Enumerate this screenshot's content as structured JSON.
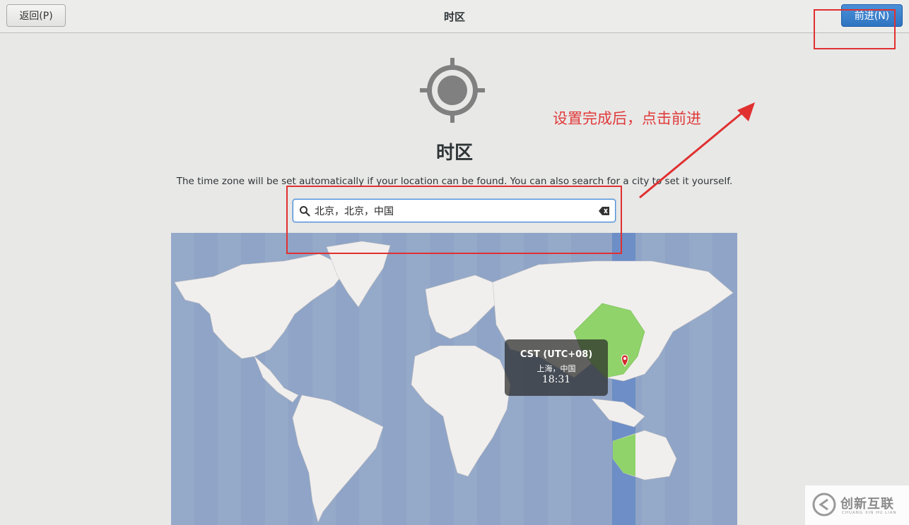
{
  "header": {
    "back_label": "返回(P)",
    "title": "时区",
    "next_label": "前进(N)"
  },
  "main": {
    "title": "时区",
    "description": "The time zone will be set automatically if your location can be found. You can also search for a city to set it yourself.",
    "search": {
      "value": "北京，北京，中国"
    }
  },
  "map": {
    "tooltip": {
      "zone": "CST (UTC+08)",
      "city": "上海，中国",
      "time": "18:31"
    }
  },
  "annotation": {
    "text": "设置完成后，点击前进"
  },
  "watermark": {
    "text": "创新互联",
    "sub": "CHUANG XIN HU LIAN"
  },
  "colors": {
    "accent": "#4a90d9",
    "annotation": "#e03a3a",
    "ocean": "#8fa4c6",
    "land": "#f1efee",
    "selected_country": "#8fd36a"
  },
  "icons": [
    "location-crosshair-icon",
    "search-icon",
    "clear-text-icon",
    "map-pin-icon"
  ]
}
